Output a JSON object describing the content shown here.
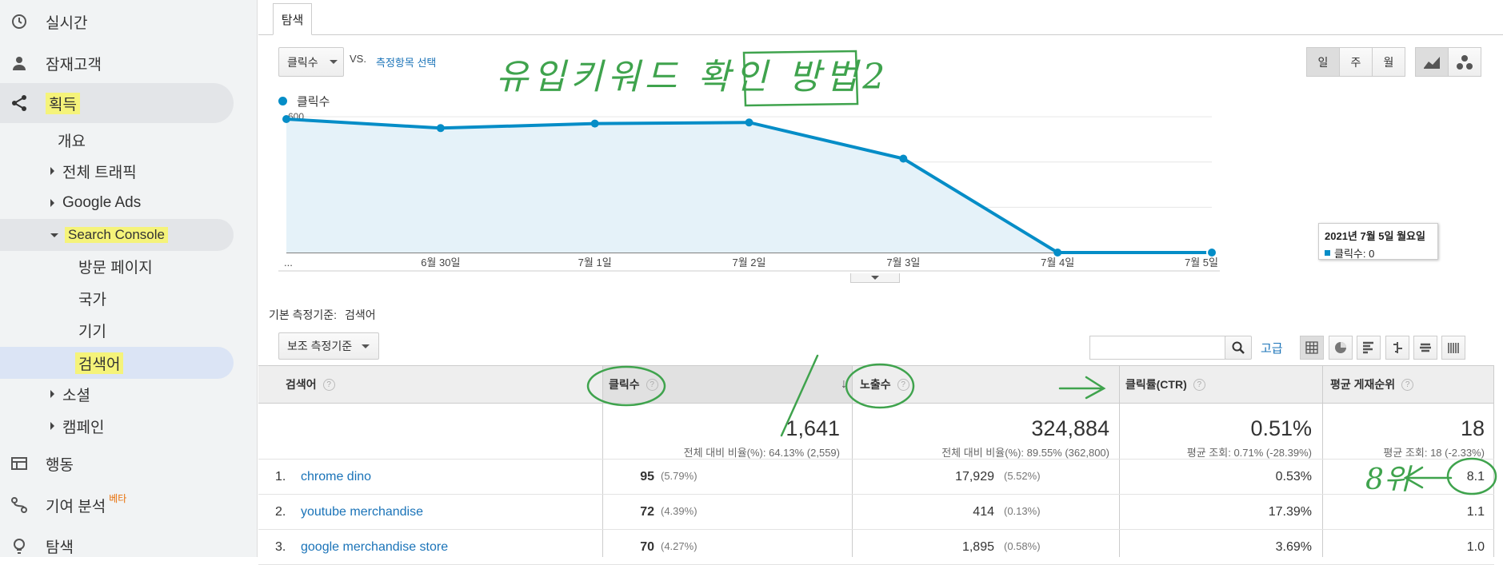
{
  "sidebar": {
    "items": [
      {
        "label": "실시간",
        "icon": "clock-icon"
      },
      {
        "label": "잠재고객",
        "icon": "person-icon"
      },
      {
        "label": "획득",
        "icon": "acquisition-icon"
      },
      {
        "label": "개요"
      },
      {
        "label": "전체 트래픽"
      },
      {
        "label": "Google Ads"
      },
      {
        "label": "Search Console"
      },
      {
        "label": "방문 페이지"
      },
      {
        "label": "국가"
      },
      {
        "label": "기기"
      },
      {
        "label": "검색어"
      },
      {
        "label": "소셜"
      },
      {
        "label": "캠페인"
      },
      {
        "label": "행동",
        "icon": "behavior-icon"
      },
      {
        "label": "기여 분석",
        "badge": "베타",
        "icon": "attribution-icon"
      },
      {
        "label": "탐색",
        "icon": "lightbulb-icon"
      }
    ]
  },
  "tab": {
    "label": "탐색"
  },
  "controls": {
    "metric_select": "클릭수",
    "vs": "VS.",
    "select_metric_link": "측정항목 선택",
    "periods": [
      "일",
      "주",
      "월"
    ],
    "legend": "클릭수"
  },
  "annotations": {
    "title": "유입키워드 확인 방법2",
    "rank": "8위"
  },
  "chart_data": {
    "type": "area",
    "x": [
      "...",
      "6월 30일",
      "7월 1일",
      "7월 2일",
      "7월 3일",
      "7월 4일",
      "7월 5일"
    ],
    "series": [
      {
        "name": "클릭수",
        "values": [
          590,
          550,
          570,
          575,
          415,
          0,
          0
        ]
      }
    ],
    "ylim": [
      0,
      650
    ],
    "yticks": [
      200,
      400,
      600
    ],
    "grid": true,
    "color": "#058dc7",
    "tooltip": {
      "date": "2021년 7월 5일 월요일",
      "label": "클릭수: 0"
    }
  },
  "dimension": {
    "label": "기본 측정기준:",
    "value": "검색어",
    "secondary": "보조 측정기준"
  },
  "search": {
    "placeholder": "",
    "advanced": "고급"
  },
  "table": {
    "headers": [
      "검색어",
      "클릭수",
      "노출수",
      "클릭률(CTR)",
      "평균 게재순위"
    ],
    "totals": [
      {
        "value": "1,641",
        "sub": "전체 대비 비율(%): 64.13% (2,559)"
      },
      {
        "value": "324,884",
        "sub": "전체 대비 비율(%): 89.55% (362,800)"
      },
      {
        "value": "0.51%",
        "sub": "평균 조회: 0.71% (-28.39%)"
      },
      {
        "value": "18",
        "sub": "평균 조회: 18 (-2.33%)"
      }
    ],
    "rows": [
      {
        "n": "1.",
        "q": "chrome dino",
        "clicks": "95",
        "clicks_pct": "(5.79%)",
        "impr": "17,929",
        "impr_pct": "(5.52%)",
        "ctr": "0.53%",
        "pos": "8.1"
      },
      {
        "n": "2.",
        "q": "youtube merchandise",
        "clicks": "72",
        "clicks_pct": "(4.39%)",
        "impr": "414",
        "impr_pct": "(0.13%)",
        "ctr": "17.39%",
        "pos": "1.1"
      },
      {
        "n": "3.",
        "q": "google merchandise store",
        "clicks": "70",
        "clicks_pct": "(4.27%)",
        "impr": "1,895",
        "impr_pct": "(0.58%)",
        "ctr": "3.69%",
        "pos": "1.0"
      }
    ]
  }
}
